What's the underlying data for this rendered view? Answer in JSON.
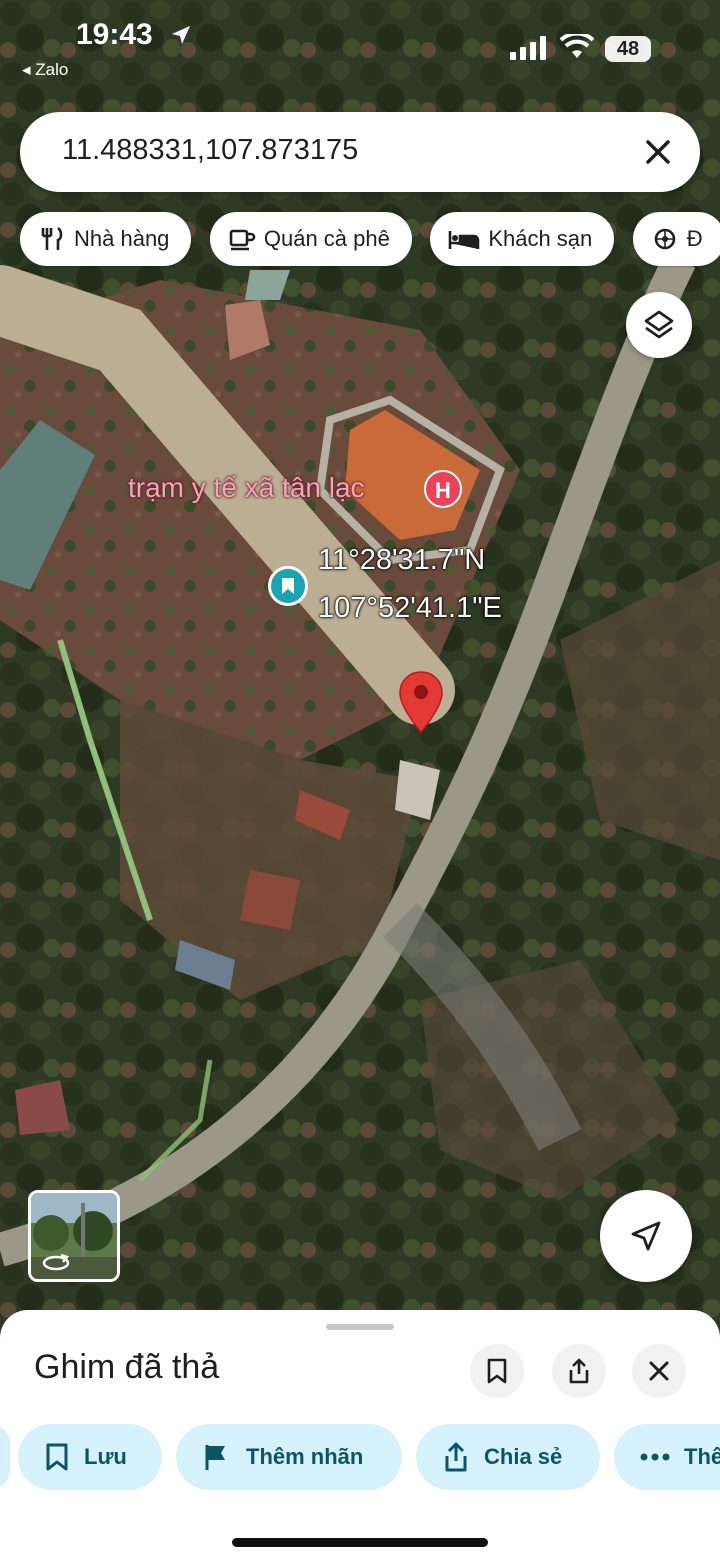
{
  "status_bar": {
    "time": "19:43",
    "back_app": "◂ Zalo",
    "battery": "48"
  },
  "search": {
    "value": "11.488331,107.873175"
  },
  "categories": [
    {
      "label": "Nhà hàng",
      "icon": "restaurant-icon"
    },
    {
      "label": "Quán cà phê",
      "icon": "coffee-icon"
    },
    {
      "label": "Khách sạn",
      "icon": "hotel-icon"
    },
    {
      "label": "Đ",
      "icon": "attraction-icon"
    }
  ],
  "map": {
    "place_label": "trạm y tế xã tân lạc",
    "place_icon_letter": "H",
    "coord_lat": "11°28'31.7\"N",
    "coord_lng": "107°52'41.1\"E"
  },
  "sheet": {
    "title": "Ghim đã thả",
    "actions": [
      {
        "label": "Lưu",
        "icon": "bookmark-icon"
      },
      {
        "label": "Thêm nhãn",
        "icon": "flag-icon"
      },
      {
        "label": "Chia sẻ",
        "icon": "share-icon"
      },
      {
        "label": "Thê",
        "icon": "more-icon"
      }
    ]
  },
  "colors": {
    "accent_chip_bg": "#d5f1fb",
    "accent_chip_text": "#0b5568",
    "pin_red": "#e53935",
    "hospital_pink": "#e8435a",
    "saved_teal": "#1aa3b0"
  }
}
